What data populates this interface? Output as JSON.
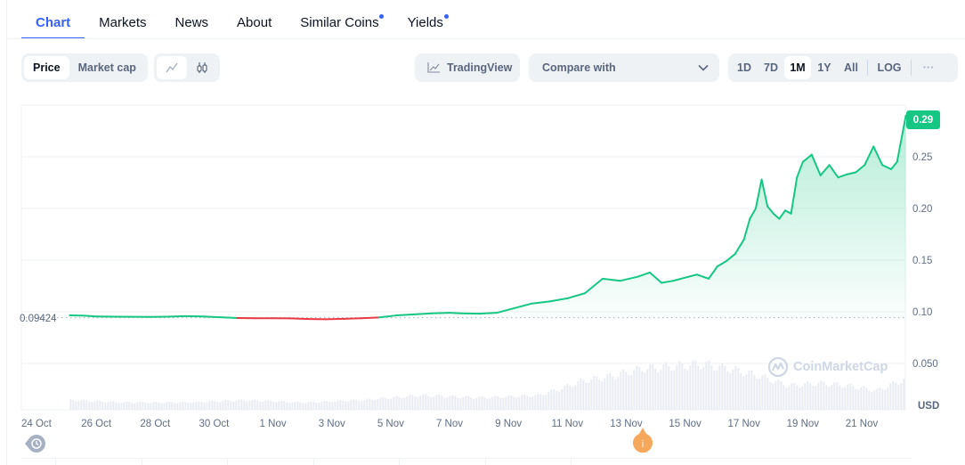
{
  "tabs": [
    {
      "label": "Chart",
      "active": true,
      "dot": false
    },
    {
      "label": "Markets",
      "active": false,
      "dot": false
    },
    {
      "label": "News",
      "active": false,
      "dot": false
    },
    {
      "label": "About",
      "active": false,
      "dot": false
    },
    {
      "label": "Similar Coins",
      "active": false,
      "dot": true
    },
    {
      "label": "Yields",
      "active": false,
      "dot": true
    }
  ],
  "toolbar": {
    "data_type": {
      "options": [
        "Price",
        "Market cap"
      ],
      "selected": "Price"
    },
    "chart_style": {
      "options": [
        "line-chart-icon",
        "candlestick-icon"
      ],
      "selected": "line-chart-icon"
    },
    "tradingview_label": "TradingView",
    "compare_placeholder": "Compare with",
    "ranges": [
      "1D",
      "7D",
      "1M",
      "1Y",
      "All"
    ],
    "selected_range": "1M",
    "log_label": "LOG",
    "more_label": "···"
  },
  "colors": {
    "accent": "#3861fb",
    "up": "#16c784",
    "down": "#ea3943",
    "event_pin": "#f5a85b",
    "history_pin": "#a6b0c3"
  },
  "overlays": {
    "current_price_badge": "0.29",
    "start_price_label": "0.09424",
    "currency_label": "USD",
    "watermark": "CoinMarketCap",
    "event_marker": "i"
  },
  "chart_data": {
    "type": "area",
    "title": "",
    "xlabel": "",
    "ylabel": "USD",
    "x_tick_labels": [
      "24 Oct",
      "26 Oct",
      "28 Oct",
      "30 Oct",
      "1 Nov",
      "3 Nov",
      "5 Nov",
      "7 Nov",
      "9 Nov",
      "11 Nov",
      "13 Nov",
      "15 Nov",
      "17 Nov",
      "19 Nov",
      "21 Nov"
    ],
    "y_tick_labels": [
      "0.050",
      "0.10",
      "0.15",
      "0.20",
      "0.25"
    ],
    "y_ticks": [
      0.05,
      0.1,
      0.15,
      0.2,
      0.25
    ],
    "ylim": [
      0.0,
      0.3
    ],
    "x_unit": "days since 24 Oct",
    "xlim": [
      0,
      29.5
    ],
    "grid": true,
    "baseline": 0.09424,
    "baseline_style": "dotted",
    "current_value": 0.29,
    "series": [
      {
        "name": "Price",
        "x": [
          1.1,
          1.6,
          2.0,
          2.6,
          3.2,
          3.8,
          4.4,
          5.0,
          5.6,
          6.2,
          6.8,
          7.4,
          8.0,
          8.6,
          9.2,
          9.8,
          10.4,
          11.0,
          11.6,
          12.2,
          12.8,
          13.4,
          14.0,
          14.4,
          15.0,
          15.6,
          16.2,
          16.8,
          17.4,
          18.0,
          18.6,
          19.2,
          19.8,
          20.4,
          20.8,
          21.2,
          21.6,
          22.0,
          22.4,
          22.8,
          23.1,
          23.4,
          23.7,
          24.0,
          24.2,
          24.4,
          24.6,
          24.8,
          25.0,
          25.2,
          25.4,
          25.6,
          25.8,
          26.0,
          26.3,
          26.6,
          26.9,
          27.2,
          27.5,
          27.8,
          28.1,
          28.4,
          28.7,
          29.0,
          29.2,
          29.5
        ],
        "values": [
          0.0965,
          0.0962,
          0.0955,
          0.0953,
          0.0952,
          0.095,
          0.0953,
          0.0958,
          0.0955,
          0.0947,
          0.094,
          0.0938,
          0.0937,
          0.0936,
          0.093,
          0.0928,
          0.0932,
          0.0938,
          0.0945,
          0.0965,
          0.0975,
          0.0985,
          0.099,
          0.0985,
          0.0982,
          0.099,
          0.1035,
          0.108,
          0.11,
          0.113,
          0.118,
          0.132,
          0.13,
          0.134,
          0.138,
          0.128,
          0.13,
          0.133,
          0.136,
          0.132,
          0.144,
          0.149,
          0.156,
          0.17,
          0.19,
          0.2,
          0.228,
          0.202,
          0.195,
          0.19,
          0.198,
          0.195,
          0.23,
          0.245,
          0.252,
          0.232,
          0.242,
          0.23,
          0.233,
          0.235,
          0.242,
          0.26,
          0.242,
          0.238,
          0.245,
          0.29
        ]
      },
      {
        "name": "Volume",
        "x": [
          1.1,
          3.0,
          5.0,
          7.0,
          9.0,
          11.0,
          13.0,
          15.0,
          17.0,
          17.8,
          18.5,
          19.5,
          20.5,
          21.5,
          22.5,
          23.5,
          24.5,
          25.5,
          26.5,
          27.5,
          28.5,
          29.5
        ],
        "values": [
          0.2,
          0.15,
          0.15,
          0.2,
          0.15,
          0.2,
          0.3,
          0.25,
          0.3,
          0.45,
          0.6,
          0.7,
          0.85,
          0.9,
          0.95,
          0.85,
          0.7,
          0.5,
          0.55,
          0.5,
          0.4,
          0.65
        ],
        "unit": "relative to panel height"
      }
    ]
  }
}
